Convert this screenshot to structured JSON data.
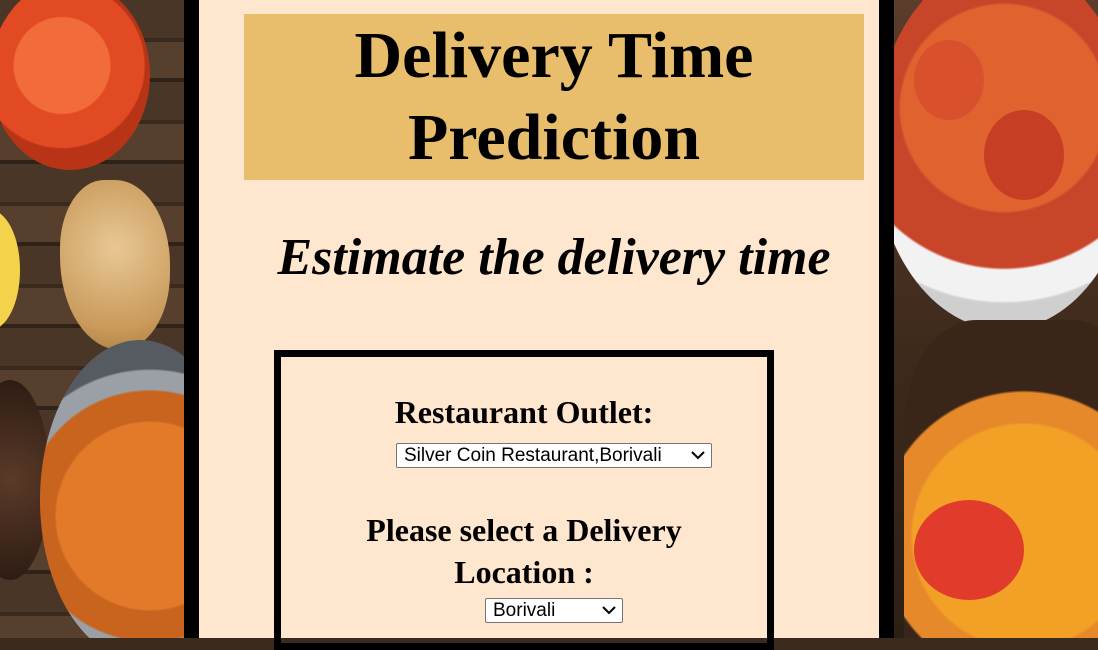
{
  "header": {
    "title_line1": "Delivery Time",
    "title_line2": "Prediction"
  },
  "subtitle": "Estimate the delivery time",
  "form": {
    "outlet_label": "Restaurant Outlet:",
    "outlet_selected": "Silver Coin Restaurant,Borivali",
    "location_label_line1": "Please select a Delivery",
    "location_label_line2": "Location :",
    "location_selected": "Borivali"
  },
  "icons": {
    "dropdown": "chevron-down-icon"
  },
  "colors": {
    "panel_bg": "#ffe6cf",
    "title_bg": "#e8bd6b",
    "frame": "#000000"
  }
}
